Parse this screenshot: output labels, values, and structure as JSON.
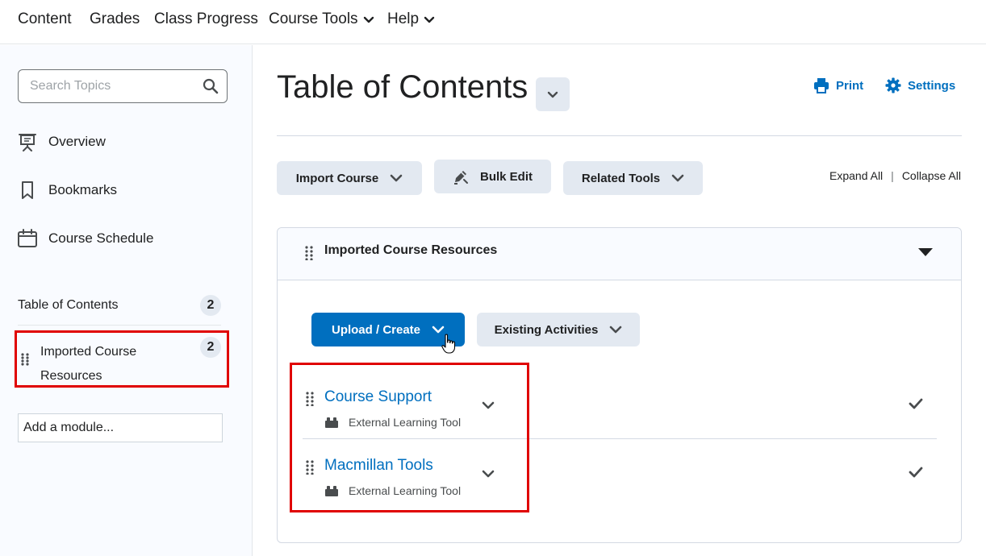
{
  "topnav": {
    "items": [
      {
        "label": "Content"
      },
      {
        "label": "Grades"
      },
      {
        "label": "Class Progress"
      },
      {
        "label": "Course Tools"
      },
      {
        "label": "Help"
      }
    ]
  },
  "sidebar": {
    "search_placeholder": "Search Topics",
    "links": [
      {
        "label": "Overview",
        "icon": "presentation-icon"
      },
      {
        "label": "Bookmarks",
        "icon": "bookmark-icon"
      },
      {
        "label": "Course Schedule",
        "icon": "calendar-icon"
      }
    ],
    "toc": {
      "label": "Table of Contents",
      "count": "2"
    },
    "modules": [
      {
        "label": "Imported Course Resources",
        "count": "2"
      }
    ],
    "add_module_placeholder": "Add a module..."
  },
  "main": {
    "title": "Table of Contents",
    "print_label": "Print",
    "settings_label": "Settings",
    "toolbar": {
      "import_label": "Import Course",
      "bulk_edit_label": "Bulk Edit",
      "related_tools_label": "Related Tools"
    },
    "expand_all": "Expand All",
    "separator": "|",
    "collapse_all": "Collapse All",
    "module": {
      "title": "Imported Course Resources",
      "upload_label": "Upload / Create",
      "existing_label": "Existing Activities",
      "topics": [
        {
          "name": "Course Support",
          "type": "External Learning Tool"
        },
        {
          "name": "Macmillan Tools",
          "type": "External Learning Tool"
        }
      ]
    }
  },
  "colors": {
    "accent": "#006fbf",
    "button_bg": "#e3e9f1",
    "highlight": "#e00000"
  }
}
